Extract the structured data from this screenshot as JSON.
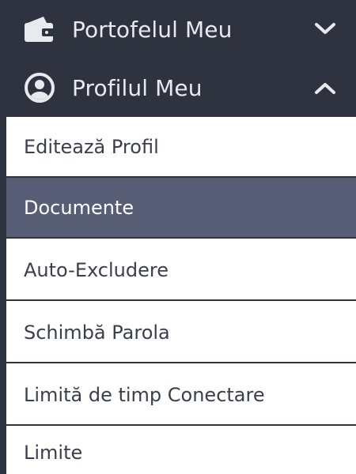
{
  "menu": {
    "wallet": {
      "label": "Portofelul Meu",
      "icon": "wallet-icon",
      "chevron": "chevron-down-icon"
    },
    "profile": {
      "label": "Profilul Meu",
      "icon": "user-circle-icon",
      "chevron": "chevron-up-icon",
      "items": [
        {
          "label": "Editează Profil",
          "active": false
        },
        {
          "label": "Documente",
          "active": true
        },
        {
          "label": "Auto-Excludere",
          "active": false
        },
        {
          "label": "Schimbă Parola",
          "active": false
        },
        {
          "label": "Limită de timp Conectare",
          "active": false
        },
        {
          "label": "Limite",
          "active": false
        }
      ]
    }
  },
  "colors": {
    "sidebar_bg": "#2e333f",
    "header_text": "#e9eaee",
    "submenu_bg": "#ffffff",
    "submenu_text": "#3a3f4c",
    "active_bg": "#575e75",
    "active_text": "#ffffff"
  }
}
